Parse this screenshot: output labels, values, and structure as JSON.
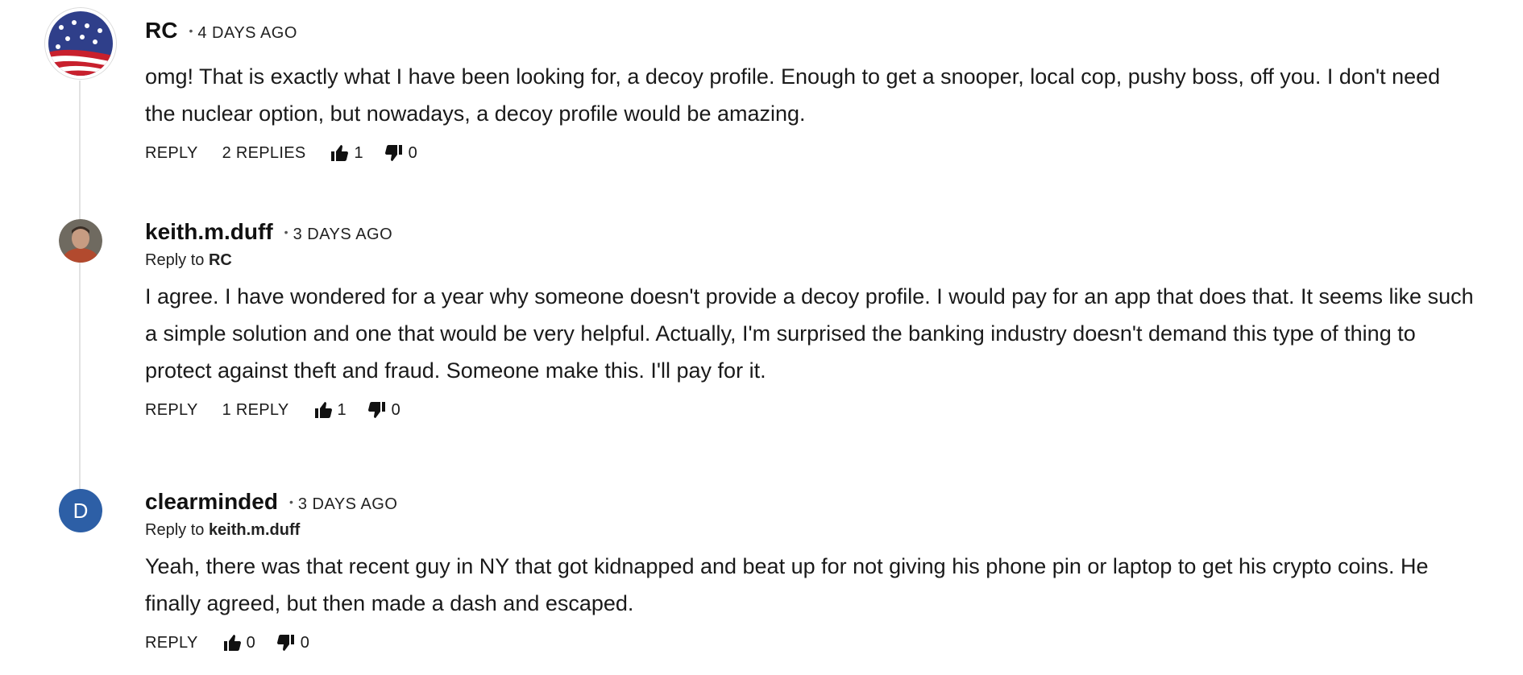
{
  "comments": [
    {
      "author": "RC",
      "time": "4 DAYS AGO",
      "avatar_icon": "us-flag-avatar",
      "text": "omg! That is exactly what I have been looking for, a decoy profile. Enough to get a snooper, local cop, pushy boss, off you. I don't need the nuclear option, but nowadays, a decoy profile would be amazing.",
      "reply_label": "REPLY",
      "replies_label": "2 REPLIES",
      "upvotes": "1",
      "downvotes": "0"
    },
    {
      "author": "keith.m.duff",
      "time": "3 DAYS AGO",
      "avatar_icon": "user-photo-avatar",
      "reply_to_prefix": "Reply to",
      "reply_to": "RC",
      "text": "I agree. I have wondered for a year why someone doesn't provide a decoy profile. I would pay for an app that does that. It seems like such a simple solution and one that would be very helpful. Actually, I'm surprised the banking industry doesn't demand this type of thing to protect against theft and fraud. Someone make this. I'll pay for it.",
      "reply_label": "REPLY",
      "replies_label": "1 REPLY",
      "upvotes": "1",
      "downvotes": "0"
    },
    {
      "author": "clearminded",
      "time": "3 DAYS AGO",
      "avatar_letter": "D",
      "avatar_color": "#2d5fa6",
      "reply_to_prefix": "Reply to",
      "reply_to": "keith.m.duff",
      "text": "Yeah, there was that recent guy in NY that got kidnapped and beat up for not giving his phone pin or laptop to get his crypto coins. He finally agreed, but then made a dash and escaped.",
      "reply_label": "REPLY",
      "upvotes": "0",
      "downvotes": "0"
    }
  ],
  "icons": {
    "upvote": "thumbs-up-icon",
    "downvote": "thumbs-down-icon"
  }
}
